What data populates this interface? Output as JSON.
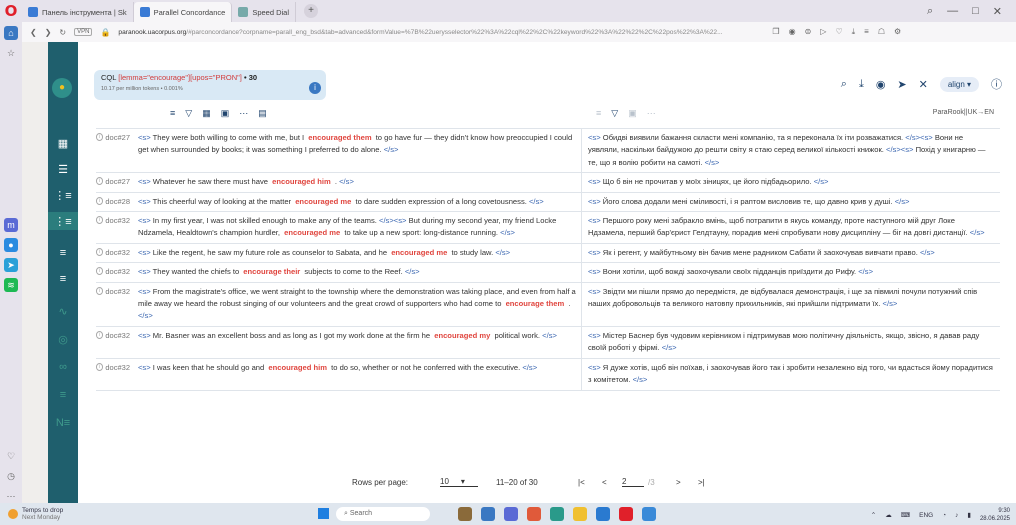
{
  "browser": {
    "tabs": [
      {
        "label": "Панель інструмента | Sk"
      },
      {
        "label": "Parallel Concordance"
      },
      {
        "label": "Speed Dial"
      }
    ],
    "url_host": "paranook.uacorpus.org",
    "url_path": "/#parconcordance?corpname=parall_eng_bsd&tab=advanced&formValue=%7B%22uerysselector%22%3A%22cql%22%2C%22keyword%22%3A%22%22%2C%22pos%22%3A%22..."
  },
  "query": {
    "cql_label": "CQL",
    "cql_text": "[lemma=\"encourage\"][upos=\"PRON\"]",
    "count": "• 30",
    "stats": "10.17 per million tokens • 0.001%",
    "align_label": "align ▾",
    "parallel_label": "ParaRook||UK→EN"
  },
  "rows": [
    {
      "doc": "doc#27",
      "l": [
        {
          "t": "<s>",
          "k": "tag"
        },
        {
          "t": " They were both willing to come with me, but I "
        },
        {
          "t": "encouraged them",
          "k": "hit"
        },
        {
          "t": " to go have fur — they didn't know how preoccupied I could get when surrounded by books; it was something I preferred to do alone. "
        },
        {
          "t": "</s>",
          "k": "tag"
        }
      ],
      "r": [
        {
          "t": "<s>",
          "k": "tag"
        },
        {
          "t": " Обидві виявили бажання скласти мені компанію, та я переконала їх іти розважатися. "
        },
        {
          "t": "</s><s>",
          "k": "tag"
        },
        {
          "t": " Вони не уявляли, наскільки байдужою до решти світу я стаю серед великої кількості книжок. "
        },
        {
          "t": "</s><s>",
          "k": "tag"
        },
        {
          "t": " Похід у книгарню — те, що я волію робити на самоті. "
        },
        {
          "t": "</s>",
          "k": "tag"
        }
      ]
    },
    {
      "doc": "doc#27",
      "l": [
        {
          "t": "<s>",
          "k": "tag"
        },
        {
          "t": " Whatever he saw there must have "
        },
        {
          "t": "encouraged him",
          "k": "hit"
        },
        {
          "t": " . "
        },
        {
          "t": "</s>",
          "k": "tag"
        }
      ],
      "r": [
        {
          "t": "<s>",
          "k": "tag"
        },
        {
          "t": " Що б він не прочитав у моїх зіницях, це його підбадьорило. "
        },
        {
          "t": "</s>",
          "k": "tag"
        }
      ]
    },
    {
      "doc": "doc#28",
      "l": [
        {
          "t": "<s>",
          "k": "tag"
        },
        {
          "t": " This cheerful way of looking at the matter "
        },
        {
          "t": "encouraged me",
          "k": "hit"
        },
        {
          "t": " to dare sudden expression of a long covetousness. "
        },
        {
          "t": "</s>",
          "k": "tag"
        }
      ],
      "r": [
        {
          "t": "<s>",
          "k": "tag"
        },
        {
          "t": " Його слова додали мені сміливості, і я раптом висловив те, що давно крив у душі. "
        },
        {
          "t": "</s>",
          "k": "tag"
        }
      ]
    },
    {
      "doc": "doc#32",
      "l": [
        {
          "t": "<s>",
          "k": "tag"
        },
        {
          "t": " In my first year, I was not skilled enough to make any of the teams. "
        },
        {
          "t": "</s><s>",
          "k": "tag"
        },
        {
          "t": " But during my second year, my friend Locke Ndzamela, Healdtown's champion hurdler, "
        },
        {
          "t": "encouraged me",
          "k": "hit"
        },
        {
          "t": " to take up a new sport: long-distance running. "
        },
        {
          "t": "</s>",
          "k": "tag"
        }
      ],
      "r": [
        {
          "t": "<s>",
          "k": "tag"
        },
        {
          "t": " Першого року мені забракло вмінь, щоб потрапити в якусь команду, проте наступного мій друг Локе Ндзамела, перший бар'єрист Гелдтауну, порадив мені спробувати нову дисципліну — біг на довгі дистанції. "
        },
        {
          "t": "</s>",
          "k": "tag"
        }
      ]
    },
    {
      "doc": "doc#32",
      "l": [
        {
          "t": "<s>",
          "k": "tag"
        },
        {
          "t": " Like the regent, he saw my future role as counselor to Sabata, and he "
        },
        {
          "t": "encouraged me",
          "k": "hit"
        },
        {
          "t": " to study law. "
        },
        {
          "t": "</s>",
          "k": "tag"
        }
      ],
      "r": [
        {
          "t": "<s>",
          "k": "tag"
        },
        {
          "t": " Як і регент, у майбутньому він бачив мене радником Сабати й заохочував вивчати право. "
        },
        {
          "t": "</s>",
          "k": "tag"
        }
      ]
    },
    {
      "doc": "doc#32",
      "l": [
        {
          "t": "<s>",
          "k": "tag"
        },
        {
          "t": " They wanted the chiefs to "
        },
        {
          "t": "encourage their",
          "k": "hit"
        },
        {
          "t": " subjects to come to the Reef. "
        },
        {
          "t": "</s>",
          "k": "tag"
        }
      ],
      "r": [
        {
          "t": "<s>",
          "k": "tag"
        },
        {
          "t": " Вони хотіли, щоб вожді заохочували своїх підданців приїздити до Рифу. "
        },
        {
          "t": "</s>",
          "k": "tag"
        }
      ]
    },
    {
      "doc": "doc#32",
      "l": [
        {
          "t": "<s>",
          "k": "tag"
        },
        {
          "t": " From the magistrate's office, we went straight to the township where the demonstration was taking place, and even from half a mile away we heard the robust singing of our volunteers and the great crowd of supporters who had come to "
        },
        {
          "t": "encourage them",
          "k": "hit"
        },
        {
          "t": " . "
        },
        {
          "t": "</s>",
          "k": "tag"
        }
      ],
      "r": [
        {
          "t": "<s>",
          "k": "tag"
        },
        {
          "t": " Звідти ми пішли прямо до передмістя, де відбувалася демонстрація, і ще за півмилі почули потужний спів наших добровольців та великого натовпу прихильників, які прийшли підтримати їх. "
        },
        {
          "t": "</s>",
          "k": "tag"
        }
      ]
    },
    {
      "doc": "doc#32",
      "l": [
        {
          "t": "<s>",
          "k": "tag"
        },
        {
          "t": " Mr. Basner was an excellent boss and as long as I got my work done at the firm he "
        },
        {
          "t": "encouraged my",
          "k": "hit"
        },
        {
          "t": " political work. "
        },
        {
          "t": "</s>",
          "k": "tag"
        }
      ],
      "r": [
        {
          "t": "<s>",
          "k": "tag"
        },
        {
          "t": " Містер Баснер був чудовим керівником і підтримував мою політичну діяльність, якщо, звісно, я давав раду своїй роботі у фірмі. "
        },
        {
          "t": "</s>",
          "k": "tag"
        }
      ]
    },
    {
      "doc": "doc#32",
      "l": [
        {
          "t": "<s>",
          "k": "tag"
        },
        {
          "t": " I was keen that he should go and "
        },
        {
          "t": "encouraged him",
          "k": "hit"
        },
        {
          "t": " to do so, whether or not he conferred with the executive. "
        },
        {
          "t": "</s>",
          "k": "tag"
        }
      ],
      "r": [
        {
          "t": "<s>",
          "k": "tag"
        },
        {
          "t": " Я дуже хотів, щоб він поїхав, і заохочував його так і зробити незалежно від того, чи вдасться йому порадитися з комітетом. "
        },
        {
          "t": "</s>",
          "k": "tag"
        }
      ]
    }
  ],
  "pager": {
    "rows_label": "Rows per page:",
    "rows_value": "10",
    "range": "11–20 of 30",
    "page": "2",
    "of_pages": "/3"
  },
  "taskbar": {
    "weather_title": "Temps to drop",
    "weather_sub": "Next Monday",
    "search": "Search",
    "lang": "ENG",
    "time": "9:30",
    "date": "28.06.2025"
  },
  "colors": {
    "sidebar": "#1f5f6d",
    "hit": "#e0463f",
    "tag": "#3a66b0",
    "cql_box": "#d9e9f5"
  }
}
